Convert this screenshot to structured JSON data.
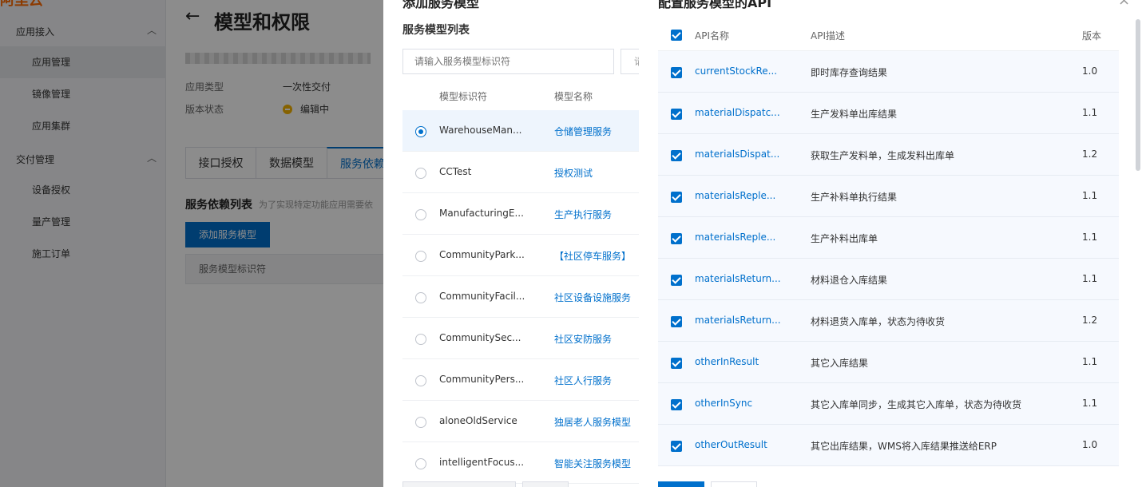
{
  "base": {
    "logo": "阿里云",
    "header": {
      "back": "←",
      "title": "模型和权限"
    },
    "sidebar": {
      "groups": [
        {
          "title": "应用接入",
          "items": [
            "应用管理",
            "镜像管理",
            "应用集群"
          ]
        },
        {
          "title": "交付管理",
          "items": [
            "设备授权",
            "量产管理",
            "施工订单"
          ]
        }
      ]
    },
    "meta": {
      "app_type_label": "应用类型",
      "app_type_value": "一次性交付",
      "version_status_label": "版本状态",
      "version_status_value": "编辑中"
    },
    "tabs": [
      "接口授权",
      "数据模型",
      "服务依赖"
    ],
    "section_title": "服务依赖列表",
    "section_hint": "为了实现特定功能应用需要依",
    "add_button": "添加服务模型",
    "table_header": "服务模型标识符"
  },
  "add_drawer": {
    "title": "添加服务模型",
    "list_title": "服务模型列表",
    "search_placeholder": "请输入服务模型标识符",
    "search2_placeholder": "请",
    "columns": {
      "id": "模型标识符",
      "name": "模型名称"
    },
    "rows": [
      {
        "id": "WarehouseMan...",
        "name": "仓储管理服务",
        "selected": true
      },
      {
        "id": "CCTest",
        "name": "授权测试",
        "selected": false
      },
      {
        "id": "ManufacturingE...",
        "name": "生产执行服务",
        "selected": false
      },
      {
        "id": "CommunityPark...",
        "name": "【社区停车服务】",
        "selected": false
      },
      {
        "id": "CommunityFacil...",
        "name": "社区设备设施服务",
        "selected": false
      },
      {
        "id": "CommunitySec...",
        "name": "社区安防服务",
        "selected": false
      },
      {
        "id": "CommunityPers...",
        "name": "社区人行服务",
        "selected": false
      },
      {
        "id": "aloneOldService",
        "name": "独居老人服务模型",
        "selected": false
      },
      {
        "id": "intelligentFocus...",
        "name": "智能关注服务模型",
        "selected": false
      }
    ]
  },
  "api_drawer": {
    "title": "配置服务模型的API",
    "close": "×",
    "columns": {
      "name": "API名称",
      "desc": "API描述",
      "version": "版本"
    },
    "rows": [
      {
        "name": "currentStockRe...",
        "desc": "即时库存查询结果",
        "version": "1.0",
        "checked": true
      },
      {
        "name": "materialDispatc...",
        "desc": "生产发料单出库结果",
        "version": "1.1",
        "checked": true
      },
      {
        "name": "materialsDispat...",
        "desc": "获取生产发料单，生成发料出库单",
        "version": "1.2",
        "checked": true
      },
      {
        "name": "materialsReple...",
        "desc": "生产补料单执行结果",
        "version": "1.1",
        "checked": true
      },
      {
        "name": "materialsReple...",
        "desc": "生产补料出库单",
        "version": "1.1",
        "checked": true
      },
      {
        "name": "materialsReturn...",
        "desc": "材料退仓入库结果",
        "version": "1.1",
        "checked": true
      },
      {
        "name": "materialsReturn...",
        "desc": "材料退货入库单，状态为待收货",
        "version": "1.2",
        "checked": true
      },
      {
        "name": "otherInResult",
        "desc": "其它入库结果",
        "version": "1.1",
        "checked": true
      },
      {
        "name": "otherInSync",
        "desc": "其它入库单同步，生成其它入库单，状态为待收货",
        "version": "1.1",
        "checked": true
      },
      {
        "name": "otherOutResult",
        "desc": "其它出库结果，WMS将入库结果推送给ERP",
        "version": "1.0",
        "checked": true
      }
    ]
  },
  "colors": {
    "primary": "#0070cc",
    "mask": "rgba(0,0,0,0.45)",
    "status_editing": "#f5b300"
  }
}
